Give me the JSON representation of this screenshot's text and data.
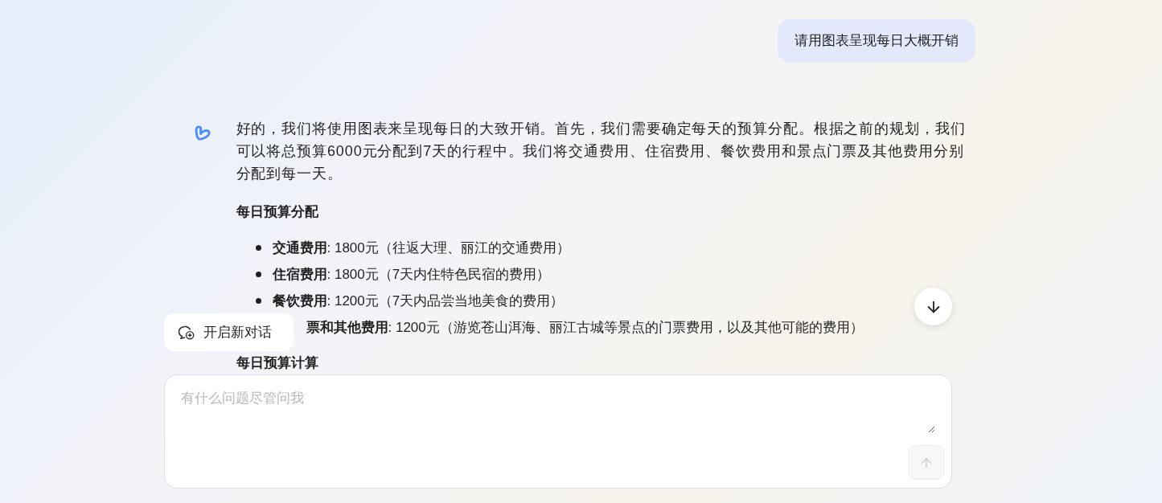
{
  "user_message": {
    "text": "请用图表呈现每日大概开销"
  },
  "assistant_message": {
    "paragraph": "好的，我们将使用图表来呈现每日的大致开销。首先，我们需要确定每天的预算分配。根据之前的规划，我们可以将总预算6000元分配到7天的行程中。我们将交通费用、住宿费用、餐饮费用和景点门票及其他费用分别分配到每一天。",
    "heading": "每日预算分配",
    "bullets": [
      {
        "kind": "full",
        "text": "**交通费用**: 1800元（往返大理、丽江的交通费用）"
      },
      {
        "kind": "full",
        "text": "**住宿费用**: 1800元（7天内住特色民宿的费用）"
      },
      {
        "kind": "full",
        "text": "**餐饮费用**: 1200元（7天内品尝当地美食的费用）"
      },
      {
        "kind": "covered",
        "text": "**票和其他费用**: 1200元（游览苍山洱海、丽江古城等景点的门票费用，以及其他可能的费用）"
      }
    ],
    "heading_2": "每日预算计算"
  },
  "new_chat_button": {
    "label": "开启新对话"
  },
  "input": {
    "placeholder": "有什么问题尽管问我",
    "send_disabled": true
  }
}
